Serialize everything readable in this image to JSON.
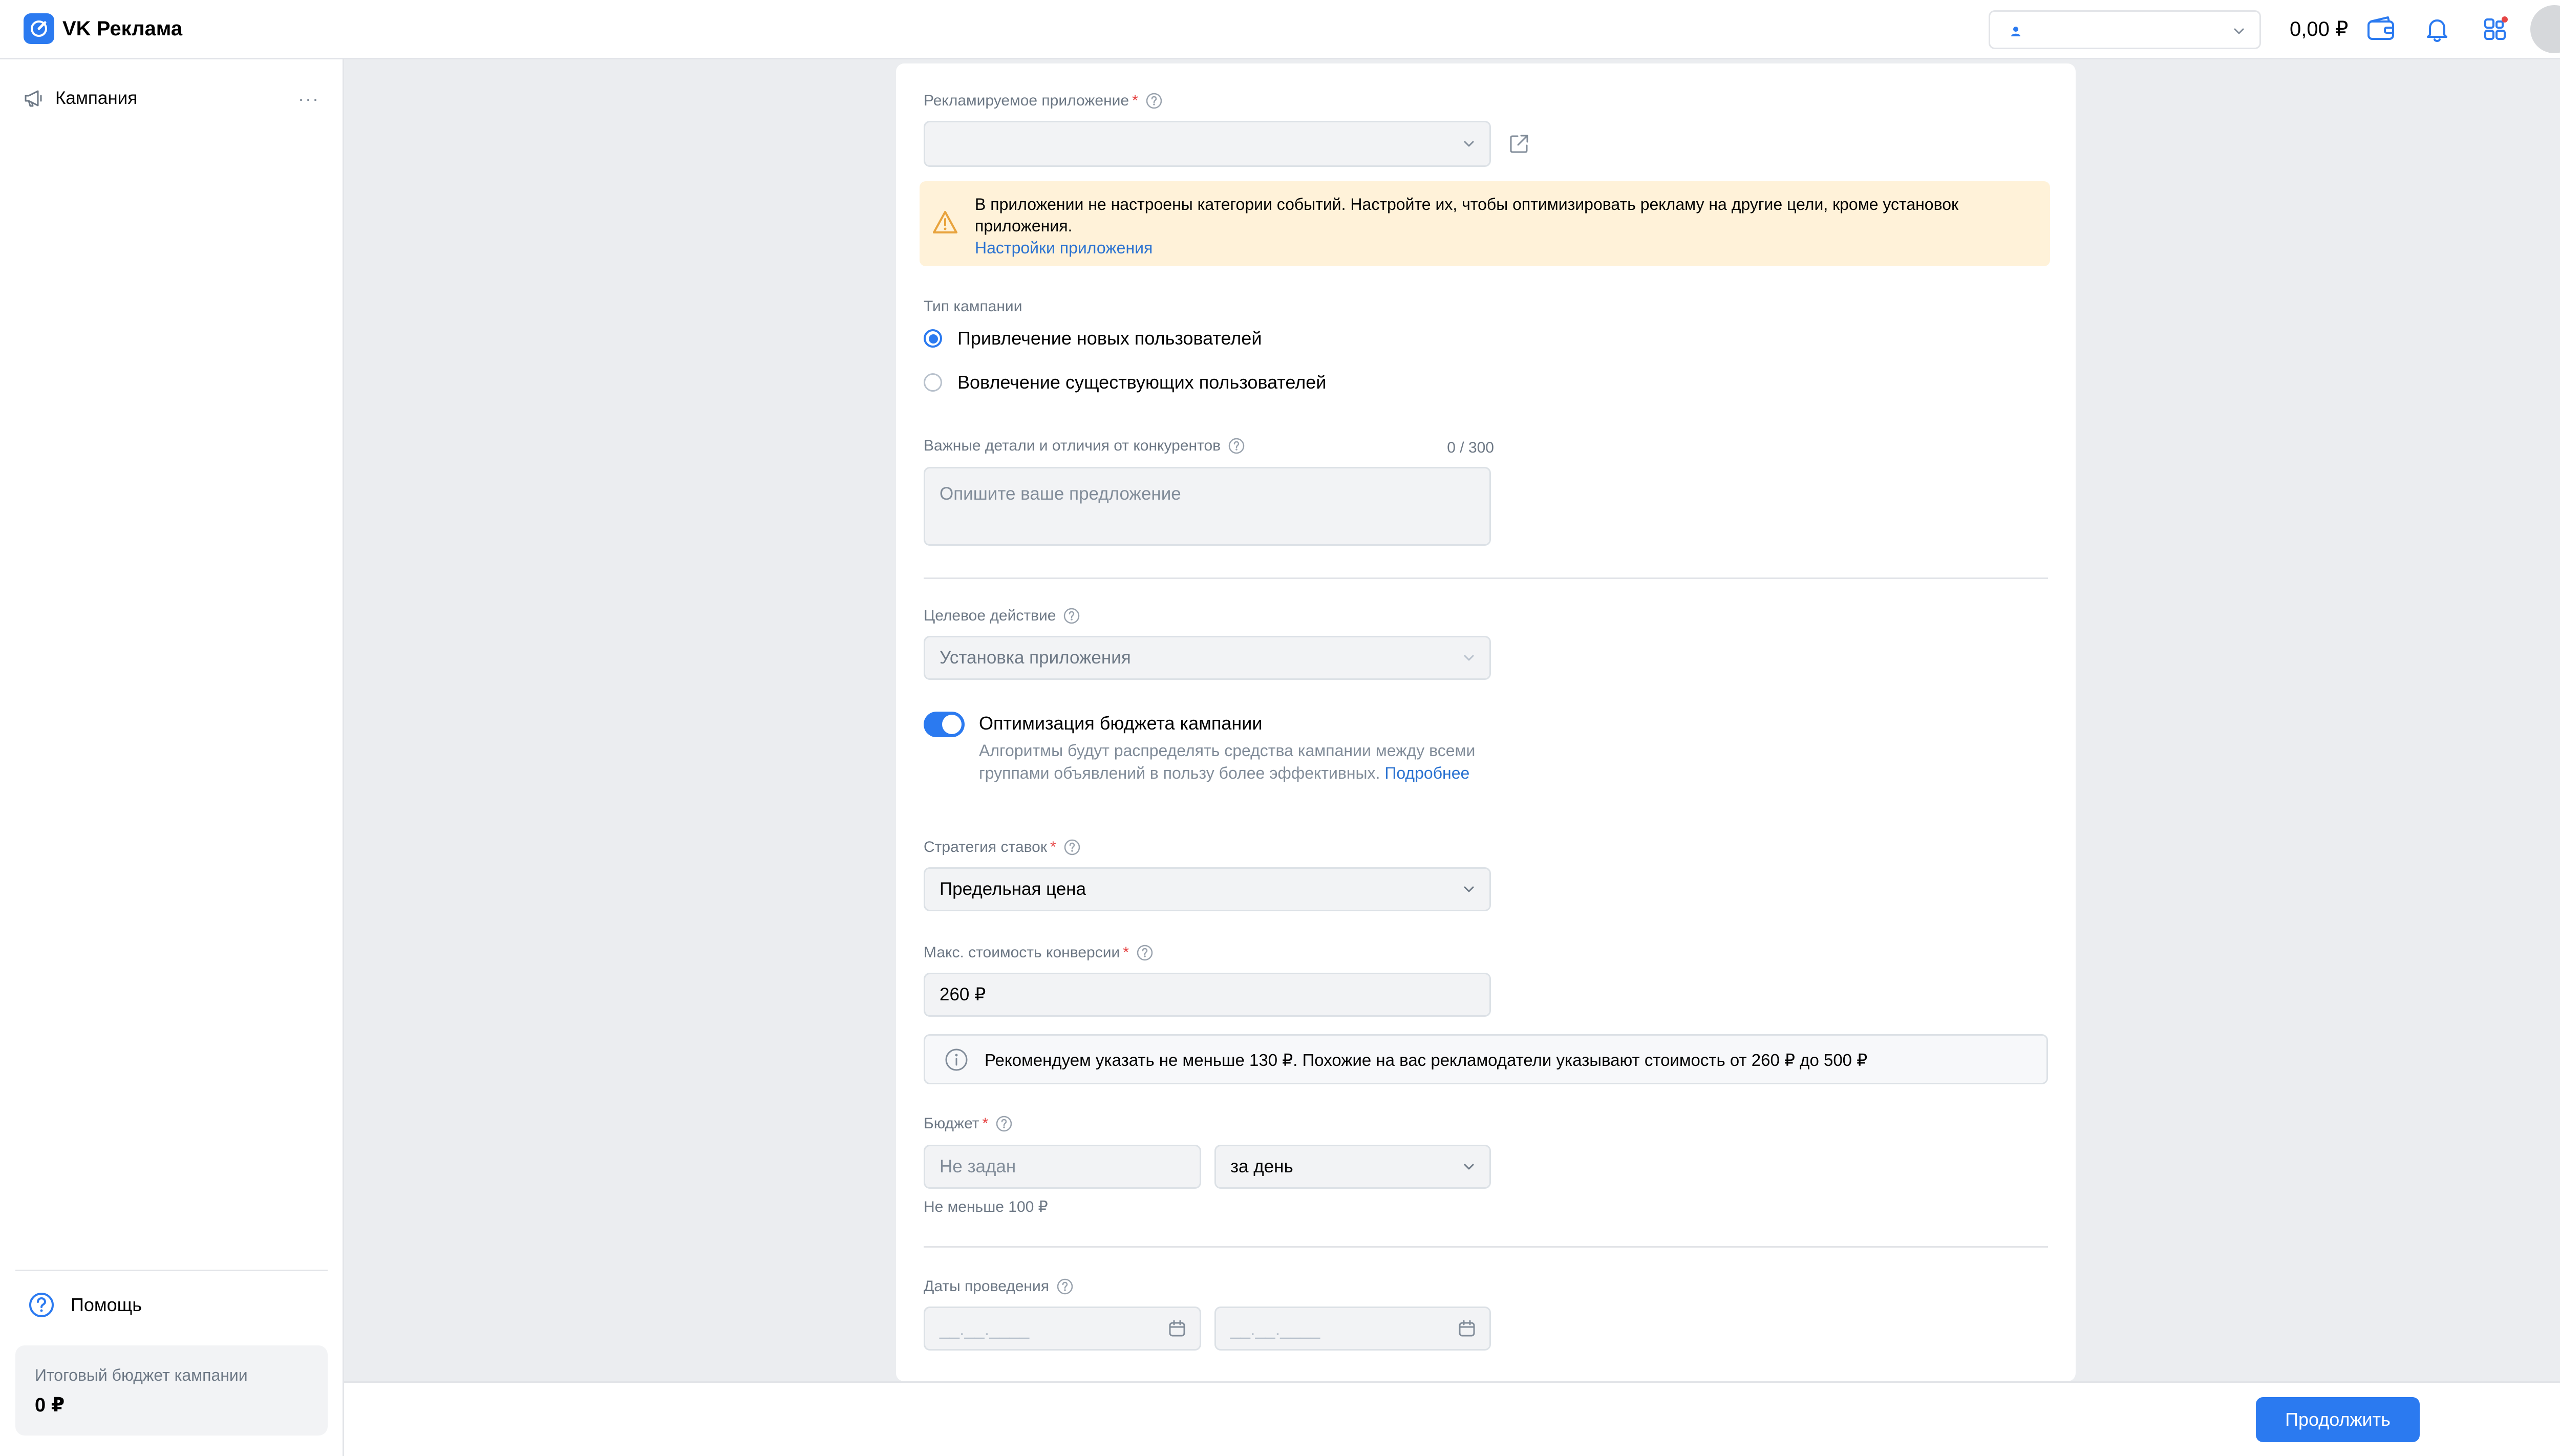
{
  "header": {
    "app_name": "VK Реклама",
    "account_placeholder": "",
    "balance": "0,00 ₽",
    "icons": [
      "wallet-icon",
      "bell-icon",
      "apps-icon",
      "avatar"
    ],
    "brand_color": "#2b7af0",
    "notification_dot_color": "#e64646"
  },
  "sidebar": {
    "campaign_label": "Кампания",
    "more_label": "···",
    "help_label": "Помощь",
    "budget_title": "Итоговый бюджет кампании",
    "budget_value": "0 ₽"
  },
  "form": {
    "app": {
      "label": "Рекламируемое приложение",
      "required_mark": "*",
      "value": ""
    },
    "warning": {
      "text": "В приложении не настроены категории событий. Настройте их, чтобы оптимизировать рекламу на другие цели, кроме установок приложения.",
      "link": "Настройки приложения"
    },
    "campaign_type": {
      "label": "Тип кампании",
      "options": [
        {
          "label": "Привлечение новых пользователей",
          "selected": true
        },
        {
          "label": "Вовлечение существующих пользователей",
          "selected": false
        }
      ]
    },
    "details": {
      "label": "Важные детали и отличия от конкурентов",
      "counter": "0 / 300",
      "placeholder": "Опишите ваше предложение"
    },
    "target_action": {
      "label": "Целевое действие",
      "value": "Установка приложения"
    },
    "budget_optimization": {
      "enabled": true,
      "title": "Оптимизация бюджета кампании",
      "description": "Алгоритмы будут распределять средства кампании между всеми группами объявлений в пользу более эффективных.",
      "link": "Подробнее"
    },
    "bid_strategy": {
      "label": "Стратегия ставок",
      "required_mark": "*",
      "value": "Предельная цена"
    },
    "max_conversion_cost": {
      "label": "Макс. стоимость конверсии",
      "required_mark": "*",
      "value": "260 ₽"
    },
    "recommendation": {
      "text": "Рекомендуем указать не меньше 130 ₽. Похожие на вас рекламодатели указывают стоимость от 260 ₽ до 500 ₽"
    },
    "budget": {
      "label": "Бюджет",
      "required_mark": "*",
      "placeholder": "Не задан",
      "period": "за день",
      "hint": "Не меньше 100 ₽"
    },
    "dates": {
      "label": "Даты проведения",
      "start_placeholder": "__.__.____",
      "end_placeholder": "__.__.____"
    }
  },
  "footer": {
    "continue_label": "Продолжить"
  }
}
